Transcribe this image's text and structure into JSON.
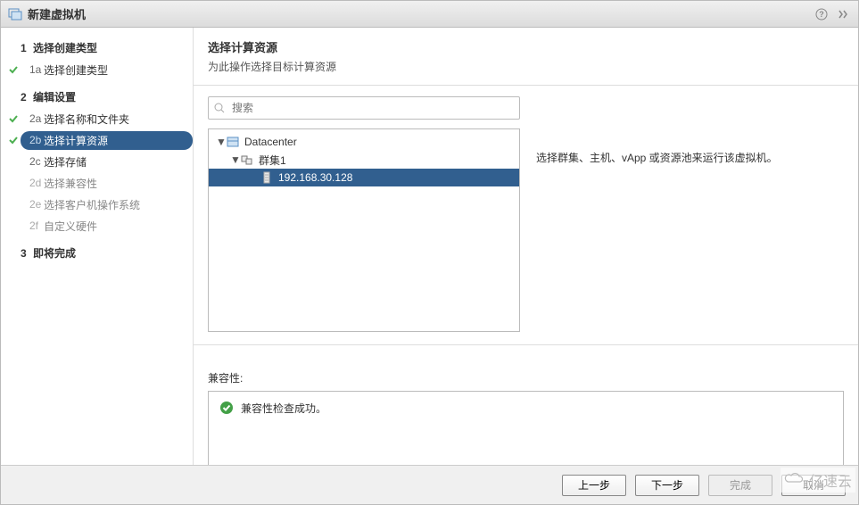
{
  "window": {
    "title": "新建虚拟机"
  },
  "sidebar": {
    "groups": [
      {
        "number": "1",
        "label": "选择创建类型",
        "items": [
          {
            "sub": "1a",
            "label": "选择创建类型",
            "done": true,
            "active": false,
            "disabled": false
          }
        ]
      },
      {
        "number": "2",
        "label": "编辑设置",
        "items": [
          {
            "sub": "2a",
            "label": "选择名称和文件夹",
            "done": true,
            "active": false,
            "disabled": false
          },
          {
            "sub": "2b",
            "label": "选择计算资源",
            "done": true,
            "active": true,
            "disabled": false
          },
          {
            "sub": "2c",
            "label": "选择存储",
            "done": false,
            "active": false,
            "disabled": false
          },
          {
            "sub": "2d",
            "label": "选择兼容性",
            "done": false,
            "active": false,
            "disabled": true
          },
          {
            "sub": "2e",
            "label": "选择客户机操作系统",
            "done": false,
            "active": false,
            "disabled": true
          },
          {
            "sub": "2f",
            "label": "自定义硬件",
            "done": false,
            "active": false,
            "disabled": true
          }
        ]
      },
      {
        "number": "3",
        "label": "即将完成",
        "items": []
      }
    ]
  },
  "main": {
    "title": "选择计算资源",
    "subtitle": "为此操作选择目标计算资源",
    "search_placeholder": "搜索",
    "hint": "选择群集、主机、vApp 或资源池来运行该虚拟机。",
    "tree": {
      "datacenter": "Datacenter",
      "cluster": "群集1",
      "host": "192.168.30.128"
    },
    "compat_label": "兼容性:",
    "compat_msg": "兼容性检查成功。"
  },
  "footer": {
    "back": "上一步",
    "next": "下一步",
    "finish": "完成",
    "cancel": "取消"
  },
  "watermark": "亿速云"
}
